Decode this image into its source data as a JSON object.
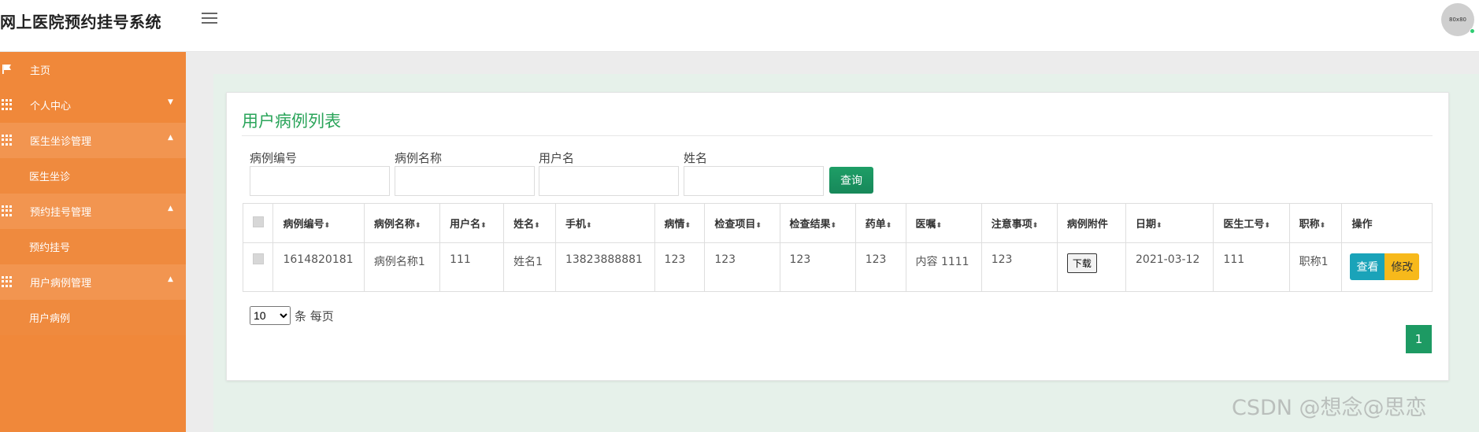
{
  "app": {
    "title": "网上医院预约挂号系统",
    "avatar_text": "80x80"
  },
  "sidebar": {
    "items": [
      {
        "label": "主页",
        "icon": "flag-icon",
        "type": "top"
      },
      {
        "label": "个人中心",
        "icon": "grid-icon",
        "type": "group",
        "chevron": "▼"
      },
      {
        "label": "医生坐诊管理",
        "icon": "grid-icon",
        "type": "group-open",
        "chevron": "▲"
      },
      {
        "label": "医生坐诊",
        "type": "sub"
      },
      {
        "label": "预约挂号管理",
        "icon": "grid-icon",
        "type": "group-open",
        "chevron": "▲"
      },
      {
        "label": "预约挂号",
        "type": "sub"
      },
      {
        "label": "用户病例管理",
        "icon": "grid-icon",
        "type": "group-open",
        "chevron": "▲"
      },
      {
        "label": "用户病例",
        "type": "sub"
      }
    ]
  },
  "card": {
    "title": "用户病例列表"
  },
  "search": {
    "fields": [
      {
        "label": "病例编号",
        "value": ""
      },
      {
        "label": "病例名称",
        "value": ""
      },
      {
        "label": "用户名",
        "value": ""
      },
      {
        "label": "姓名",
        "value": ""
      }
    ],
    "button": "查询"
  },
  "table": {
    "columns": [
      "病例编号",
      "病例名称",
      "用户名",
      "姓名",
      "手机",
      "病情",
      "检查项目",
      "检查结果",
      "药单",
      "医嘱",
      "注意事项",
      "病例附件",
      "日期",
      "医生工号",
      "职称",
      "操作"
    ],
    "sortable": [
      true,
      true,
      true,
      true,
      true,
      true,
      true,
      true,
      true,
      true,
      true,
      false,
      true,
      true,
      true,
      false
    ],
    "sort_glyph": "⬍",
    "rows": [
      {
        "cells": [
          "1614820181",
          "病例名称1",
          "111",
          "姓名1",
          "13823888881",
          "123",
          "123",
          "123",
          "123",
          "内容 1111",
          "123",
          "",
          "2021-03-12",
          "111",
          "职称1"
        ],
        "download": "下载",
        "view": "查看",
        "edit": "修改"
      }
    ]
  },
  "pagination": {
    "page_size": "10",
    "page_size_suffix": "条 每页",
    "current_page": "1"
  },
  "watermark": "CSDN @想念@思恋",
  "colors": {
    "sidebar": "#f0883a",
    "primary_green": "#2aa45a",
    "view_button": "#1aa3b9",
    "edit_button": "#f7b91b"
  }
}
